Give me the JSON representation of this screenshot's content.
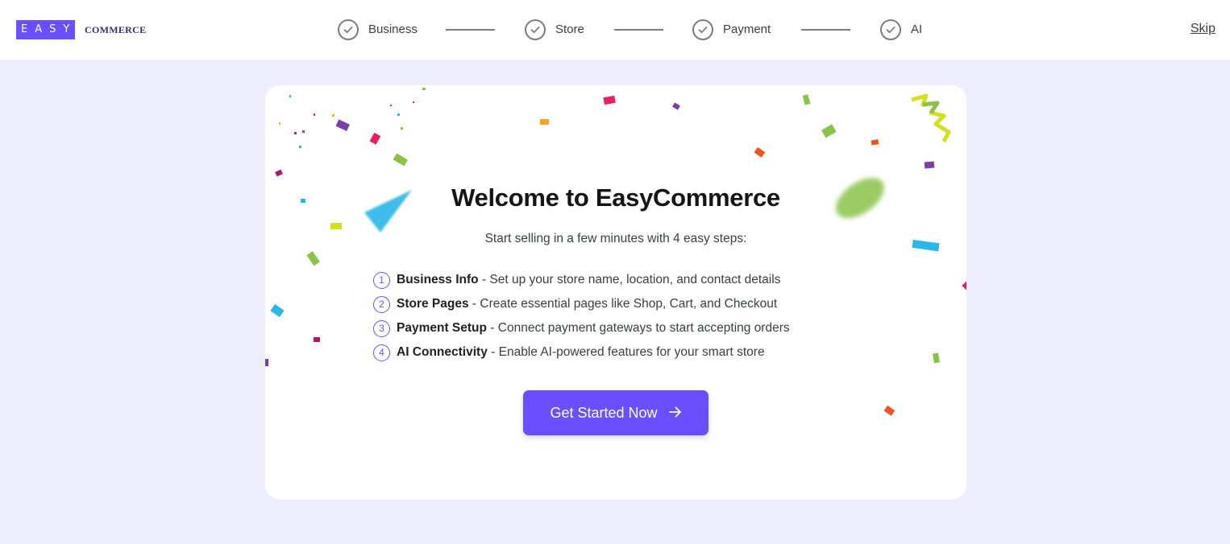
{
  "header": {
    "logo": {
      "mark": "EASY",
      "word": "COMMERCE"
    },
    "steps": [
      {
        "label": "Business",
        "icon": "check-circle-icon",
        "state": "completed"
      },
      {
        "label": "Store",
        "icon": "check-circle-icon",
        "state": "completed"
      },
      {
        "label": "Payment",
        "icon": "check-circle-icon",
        "state": "completed"
      },
      {
        "label": "AI",
        "icon": "check-circle-icon",
        "state": "completed"
      }
    ],
    "skip_label": "Skip"
  },
  "welcome": {
    "title": "Welcome to EasyCommerce",
    "subtitle": "Start selling in a few minutes with 4 easy steps:",
    "steps": [
      {
        "number": "1",
        "name": "Business Info",
        "description": "Set up your store name, location, and contact details"
      },
      {
        "number": "2",
        "name": "Store Pages",
        "description": "Create essential pages like Shop, Cart, and Checkout"
      },
      {
        "number": "3",
        "name": "Payment Setup",
        "description": "Connect payment gateways to start accepting orders"
      },
      {
        "number": "4",
        "name": "AI Connectivity",
        "description": "Enable AI-powered features for your smart store"
      }
    ],
    "cta_label": "Get Started Now",
    "cta_icon": "arrow-right-icon"
  },
  "colors": {
    "accent": "#6b4eff",
    "page_background": "#ededfd",
    "card_background": "#ffffff",
    "step_icon": "#777d8c"
  }
}
